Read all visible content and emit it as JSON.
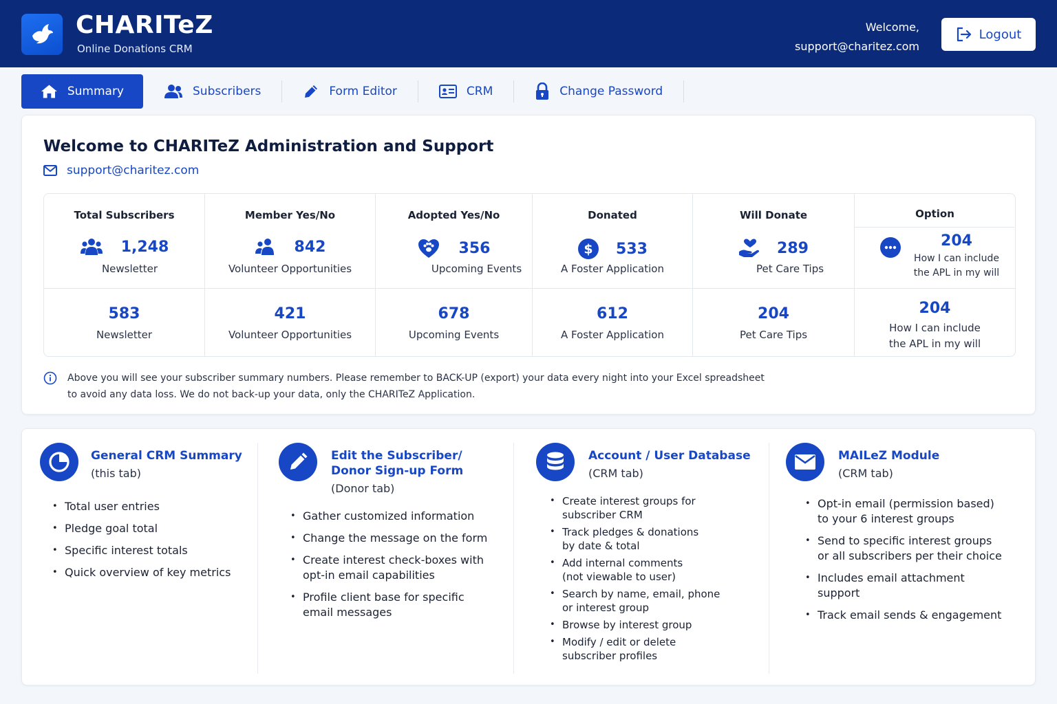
{
  "header": {
    "brand": "CHARITeZ",
    "subtitle": "Online Donations CRM",
    "welcome_line1": "Welcome,",
    "welcome_email": "support@charitez.com",
    "logout_label": "Logout",
    "bg_color": "#0b2a7a"
  },
  "tabs": [
    {
      "label": "Summary",
      "icon": "home-icon",
      "active": true
    },
    {
      "label": "Subscribers",
      "icon": "users-icon",
      "active": false
    },
    {
      "label": "Form Editor",
      "icon": "pencil-icon",
      "active": false
    },
    {
      "label": "CRM",
      "icon": "id-card-icon",
      "active": false
    },
    {
      "label": "Change Password",
      "icon": "lock-icon",
      "active": false
    }
  ],
  "summary": {
    "title": "Welcome to CHARITeZ Administration and Support",
    "email": "support@charitez.com",
    "columns": [
      {
        "header": "Total Subscribers",
        "icon": "users-icon",
        "value": "1,248",
        "label": "Newsletter",
        "lower_value": "583",
        "lower_label": "Newsletter"
      },
      {
        "header": "Member Yes/No",
        "icon": "users-icon",
        "value": "842",
        "label": "Volunteer Opportunities",
        "lower_value": "421",
        "lower_label": "Volunteer Opportunities"
      },
      {
        "header": "Adopted Yes/No",
        "icon": "paw-heart-icon",
        "value": "356",
        "label": "Upcoming Events",
        "lower_value": "678",
        "lower_label": "Upcoming Events"
      },
      {
        "header": "Donated",
        "icon": "dollar-icon",
        "value": "533",
        "label": "A Foster Application",
        "lower_value": "612",
        "lower_label": "A Foster Application"
      },
      {
        "header": "Will Donate",
        "icon": "hand-heart-icon",
        "value": "289",
        "label": "Pet Care Tips",
        "lower_value": "204",
        "lower_label": "Pet Care Tips"
      },
      {
        "header": "Option",
        "icon": "more-icon",
        "value": "204",
        "label_line1": "How I can include",
        "label_line2": "the APL in my will",
        "lower_value": "204",
        "lower_label_line1": "How I can include",
        "lower_label_line2": "the APL in my will"
      }
    ],
    "info_line1": "Above you will see your subscriber summary numbers. Please remember to BACK-UP (export) your data every night into your Excel spreadsheet",
    "info_line2": "to avoid any data loss. We do not back-up your data, only the CHARITeZ Application."
  },
  "features": [
    {
      "title_line1": "General CRM Summary",
      "title_line2": "",
      "note": "(this tab)",
      "icon": "pie-chart-icon",
      "items": [
        "Total user entries",
        "Pledge goal total",
        "Specific interest totals",
        "Quick overview of key metrics"
      ]
    },
    {
      "title_line1": "Edit the Subscriber/",
      "title_line2": "Donor Sign-up Form",
      "note": "(Donor tab)",
      "icon": "pencil-icon",
      "items": [
        "Gather customized information",
        "Change the message on the form",
        "Create interest check-boxes with|opt-in email capabilities",
        "Profile client base for specific|email messages"
      ]
    },
    {
      "title_line1": "Account / User Database",
      "title_line2": "",
      "note": "(CRM tab)",
      "icon": "database-icon",
      "items": [
        "Create interest groups for|subscriber CRM",
        "Track pledges & donations|by date & total",
        "Add internal comments|(not viewable to user)",
        "Search by name, email, phone|or interest group",
        "Browse by interest group",
        "Modify / edit or delete|subscriber profiles"
      ]
    },
    {
      "title_line1": "MAILeZ Module",
      "title_line2": "",
      "note": "(CRM tab)",
      "icon": "mail-icon",
      "items": [
        "Opt-in email (permission based)|to your 6 interest groups",
        "Send to specific interest groups|or all subscribers per their choice",
        "Includes email attachment|support",
        "Track email sends & engagement"
      ]
    }
  ]
}
